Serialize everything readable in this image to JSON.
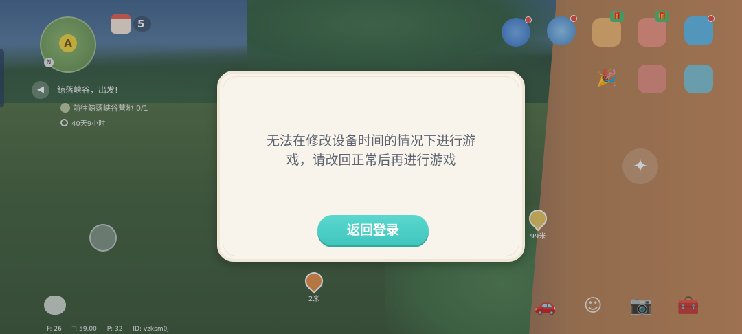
{
  "hud": {
    "minimap_player_letter": "A",
    "minimap_north": "N",
    "calendar_count": "5",
    "quest": {
      "title": "鲸落峡谷，出发!",
      "goal": "前往鲸落峡谷营地",
      "goal_progress": "0/1",
      "time_left": "40天9小时"
    }
  },
  "markers": [
    {
      "label": "99米",
      "color": "#e8c45a"
    },
    {
      "label": "2米",
      "color": "#e58a3c"
    }
  ],
  "debug": {
    "fps": "F: 26",
    "time": "T: 59.00",
    "ping": "P: 32",
    "id": "ID: vzksm0j"
  },
  "modal": {
    "message_line1": "无法在修改设备时间的情况下进行游",
    "message_line2": "戏，请改回正常后再进行游戏",
    "button_label": "返回登录"
  },
  "colors": {
    "accent": "#3fc6bd",
    "modal_bg": "#f8f4ec",
    "message_text": "#5d6470"
  }
}
